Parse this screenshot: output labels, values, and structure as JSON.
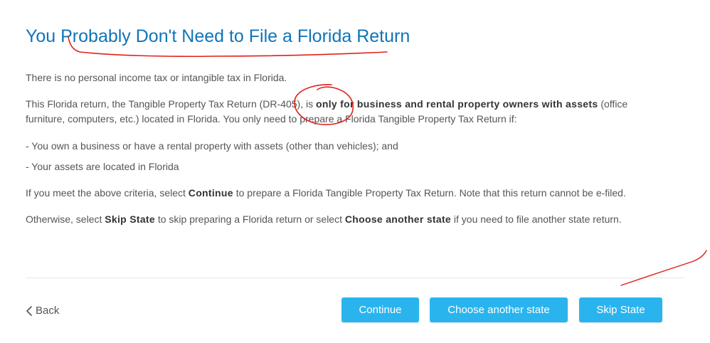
{
  "header": {
    "title": "You Probably Don't Need to File a Florida Return"
  },
  "content": {
    "p1": "There is no personal income tax or intangible tax in Florida.",
    "p2_a": "This Florida return, the Tangible Property Tax Return (DR-405), is ",
    "p2_bold": "only for business and rental property owners with assets",
    "p2_b": " (office furniture, computers, etc.) located in Florida. You only need to prepare a Florida Tangible Property Tax Return if:",
    "bullet1": "- You own a business or have a rental property with assets (other than vehicles); and",
    "bullet2": "- Your assets are located in Florida",
    "p5_a": "If you meet the above criteria, select ",
    "p5_bold": "Continue",
    "p5_b": " to prepare a Florida Tangible Property Tax Return. Note that this return cannot be e-filed.",
    "p6_a": "Otherwise, select ",
    "p6_bold1": "Skip State",
    "p6_b": " to skip preparing a Florida return or select ",
    "p6_bold2": "Choose another state",
    "p6_c": " if you need to file another state return."
  },
  "footer": {
    "back_label": "Back",
    "continue_label": "Continue",
    "choose_label": "Choose another state",
    "skip_label": "Skip State"
  },
  "colors": {
    "title": "#0f75b8",
    "button": "#2ab4ee",
    "annotation": "#e0201b"
  }
}
